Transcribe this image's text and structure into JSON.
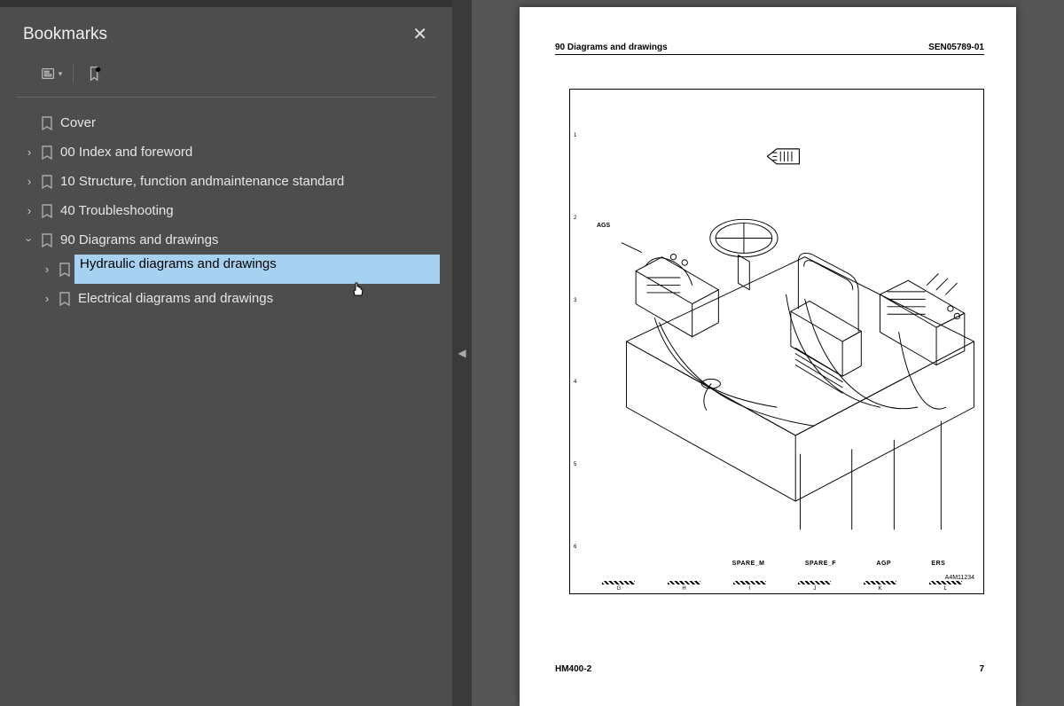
{
  "sidebar": {
    "title": "Bookmarks",
    "items": [
      {
        "label": "Cover",
        "expandable": false,
        "level": 0
      },
      {
        "label": "00 Index and foreword",
        "expandable": true,
        "level": 0
      },
      {
        "label": "10 Structure, function andmaintenance standard",
        "expandable": true,
        "level": 0
      },
      {
        "label": "40 Troubleshooting",
        "expandable": true,
        "level": 0
      },
      {
        "label": "90 Diagrams and drawings",
        "expandable": true,
        "expanded": true,
        "level": 0
      },
      {
        "label": "Hydraulic diagrams and drawings",
        "expandable": true,
        "level": 1,
        "selected": true
      },
      {
        "label": "Electrical diagrams and drawings",
        "expandable": true,
        "level": 1
      }
    ]
  },
  "page": {
    "header_left": "90 Diagrams and drawings",
    "header_right": "SEN05789-01",
    "drawing_id": "A4M11234",
    "ags_label": "AGS",
    "callouts": [
      "SPARE_M",
      "SPARE_F",
      "AGP",
      "ERS"
    ],
    "ruler_h": [
      "G",
      "H",
      "I",
      "J",
      "K",
      "L"
    ],
    "ruler_v": [
      "1",
      "2",
      "3",
      "4",
      "5",
      "6"
    ],
    "footer_left": "HM400-2",
    "footer_right": "7"
  }
}
